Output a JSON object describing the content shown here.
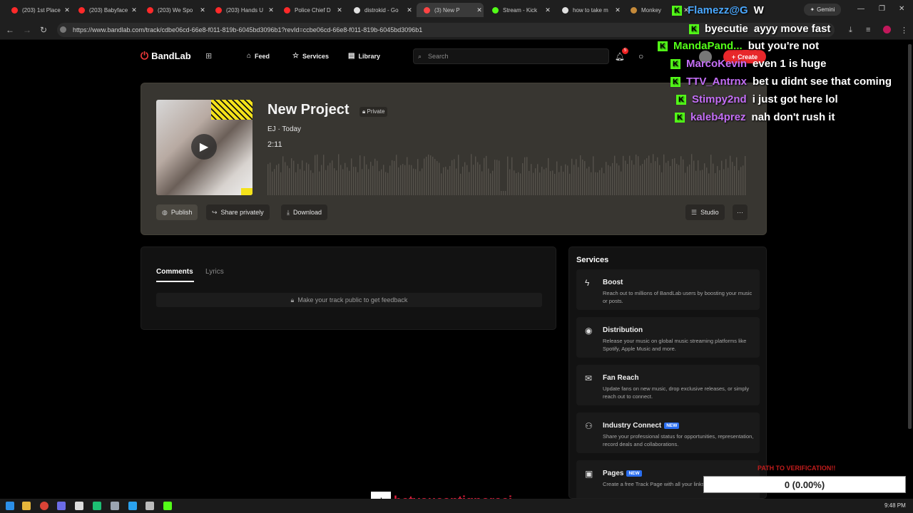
{
  "browser": {
    "tabs": [
      {
        "label": "(203) 1st Place",
        "color": "#ff2a2a"
      },
      {
        "label": "(203) Babyface",
        "color": "#ff2a2a"
      },
      {
        "label": "(203) We Spo",
        "color": "#ff2a2a"
      },
      {
        "label": "(203) Hands U",
        "color": "#ff2a2a"
      },
      {
        "label": "Police Chief D",
        "color": "#ff2a2a"
      },
      {
        "label": "distrokid - Go",
        "color": "#e0e0e0"
      },
      {
        "label": "(3) New P",
        "color": "#ff4444"
      },
      {
        "label": "Stream - Kick",
        "color": "#53fc18"
      },
      {
        "label": "how to take m",
        "color": "#e0e0e0"
      },
      {
        "label": "Monkey",
        "color": "#c58a3a"
      }
    ],
    "gemini_label": "Gemini",
    "url": "https://www.bandlab.com/track/cdbe06cd-66e8-f011-819b-6045bd3096b1?revId=ccbe06cd-66e8-f011-819b-6045bd3096b1"
  },
  "header": {
    "logo": "BandLab",
    "nav": [
      {
        "label": "Feed",
        "icon": "home-icon"
      },
      {
        "label": "Services",
        "icon": "star-icon"
      },
      {
        "label": "Library",
        "icon": "library-icon"
      }
    ],
    "search_placeholder": "Search",
    "notifications_count": "5",
    "create_label": "Create"
  },
  "track": {
    "title": "New Project",
    "visibility": "Private",
    "artist_line": "EJ · Today",
    "duration": "2:11",
    "buttons": {
      "publish": "Publish",
      "share": "Share privately",
      "download": "Download",
      "studio": "Studio",
      "more": "···"
    }
  },
  "comments": {
    "tabs": [
      "Comments",
      "Lyrics"
    ],
    "notice": "Make your track public to get feedback"
  },
  "services": {
    "title": "Services",
    "items": [
      {
        "name": "Boost",
        "icon": "bolt-icon",
        "new": "",
        "desc": "Reach out to millions of BandLab users by boosting your music or posts."
      },
      {
        "name": "Distribution",
        "icon": "distribution-icon",
        "new": "",
        "desc": "Release your music on global music streaming platforms like Spotify, Apple Music and more."
      },
      {
        "name": "Fan Reach",
        "icon": "mail-icon",
        "new": "",
        "desc": "Update fans on new music, drop exclusive releases, or simply reach out to connect."
      },
      {
        "name": "Industry Connect",
        "icon": "people-icon",
        "new": "NEW",
        "desc": "Share your professional status for opportunities, representation, record deals and collaborations."
      },
      {
        "name": "Pages",
        "icon": "pages-icon",
        "new": "NEW",
        "desc": "Create a free Track Page with all your links in one place"
      }
    ]
  },
  "chat": [
    {
      "user": "Flamezz@G",
      "color": "#4aa8ff",
      "msg": "W"
    },
    {
      "user": "byecutie",
      "color": "#ffffff",
      "msg": "ayyy move fast"
    },
    {
      "user": "MandaPand...",
      "color": "#53fc18",
      "msg": "but you're not"
    },
    {
      "user": "MarcoKevin",
      "color": "#c36ef5",
      "msg": "even 1 is huge"
    },
    {
      "user": "TTV_Antrnx",
      "color": "#c36ef5",
      "msg": "bet u didnt see that coming"
    },
    {
      "user": "Stimpy2nd",
      "color": "#c36ef5",
      "msg": "i just got here lol"
    },
    {
      "user": "kaleb4prez",
      "color": "#c36ef5",
      "msg": "nah don't rush it"
    }
  ],
  "overlay": {
    "goal_label": "PATH TO VERIFICATION!!",
    "progress_text": "0 (0.00%)",
    "progress_value": 0,
    "watermark": "betyoucantignoreej"
  },
  "taskbar": {
    "clock": "9:48 PM"
  }
}
